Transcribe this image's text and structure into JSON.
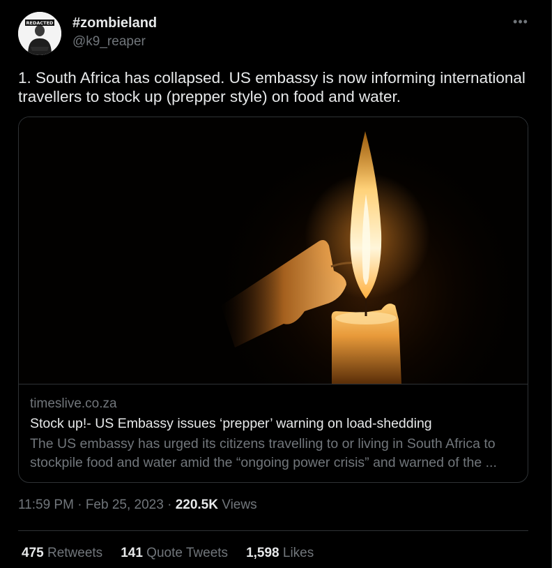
{
  "author": {
    "display_name": "#zombieland",
    "handle": "@k9_reaper",
    "avatar_badge": "REDACTED"
  },
  "more_icon": "more-horizontal-icon",
  "tweet": {
    "text_line1": "1. South Africa has collapsed. US embassy is now informing international",
    "text_line2": "travellers to stock up (prepper style) on food and water."
  },
  "card": {
    "image_subject": "candle-flame-image",
    "domain": "timeslive.co.za",
    "title": "Stock up!- US Embassy issues ‘prepper’ warning on load-shedding",
    "description_line1": "The US embassy has urged its citizens travelling to or living in South Africa to",
    "description_line2": "stockpile food and water amid the “ongoing power crisis” and warned of the ..."
  },
  "meta": {
    "time": "11:59 PM",
    "dot1": " · ",
    "date": "Feb 25, 2023",
    "dot2": " · ",
    "views_count": "220.5K",
    "views_label": " Views"
  },
  "stats": {
    "retweets_count": "475",
    "retweets_label": " Retweets",
    "quotes_count": "141",
    "quotes_label": " Quote Tweets",
    "likes_count": "1,598",
    "likes_label": " Likes"
  },
  "colors": {
    "background": "#000000",
    "text": "#e7e9ea",
    "muted": "#71767b",
    "border": "#2f3336"
  }
}
